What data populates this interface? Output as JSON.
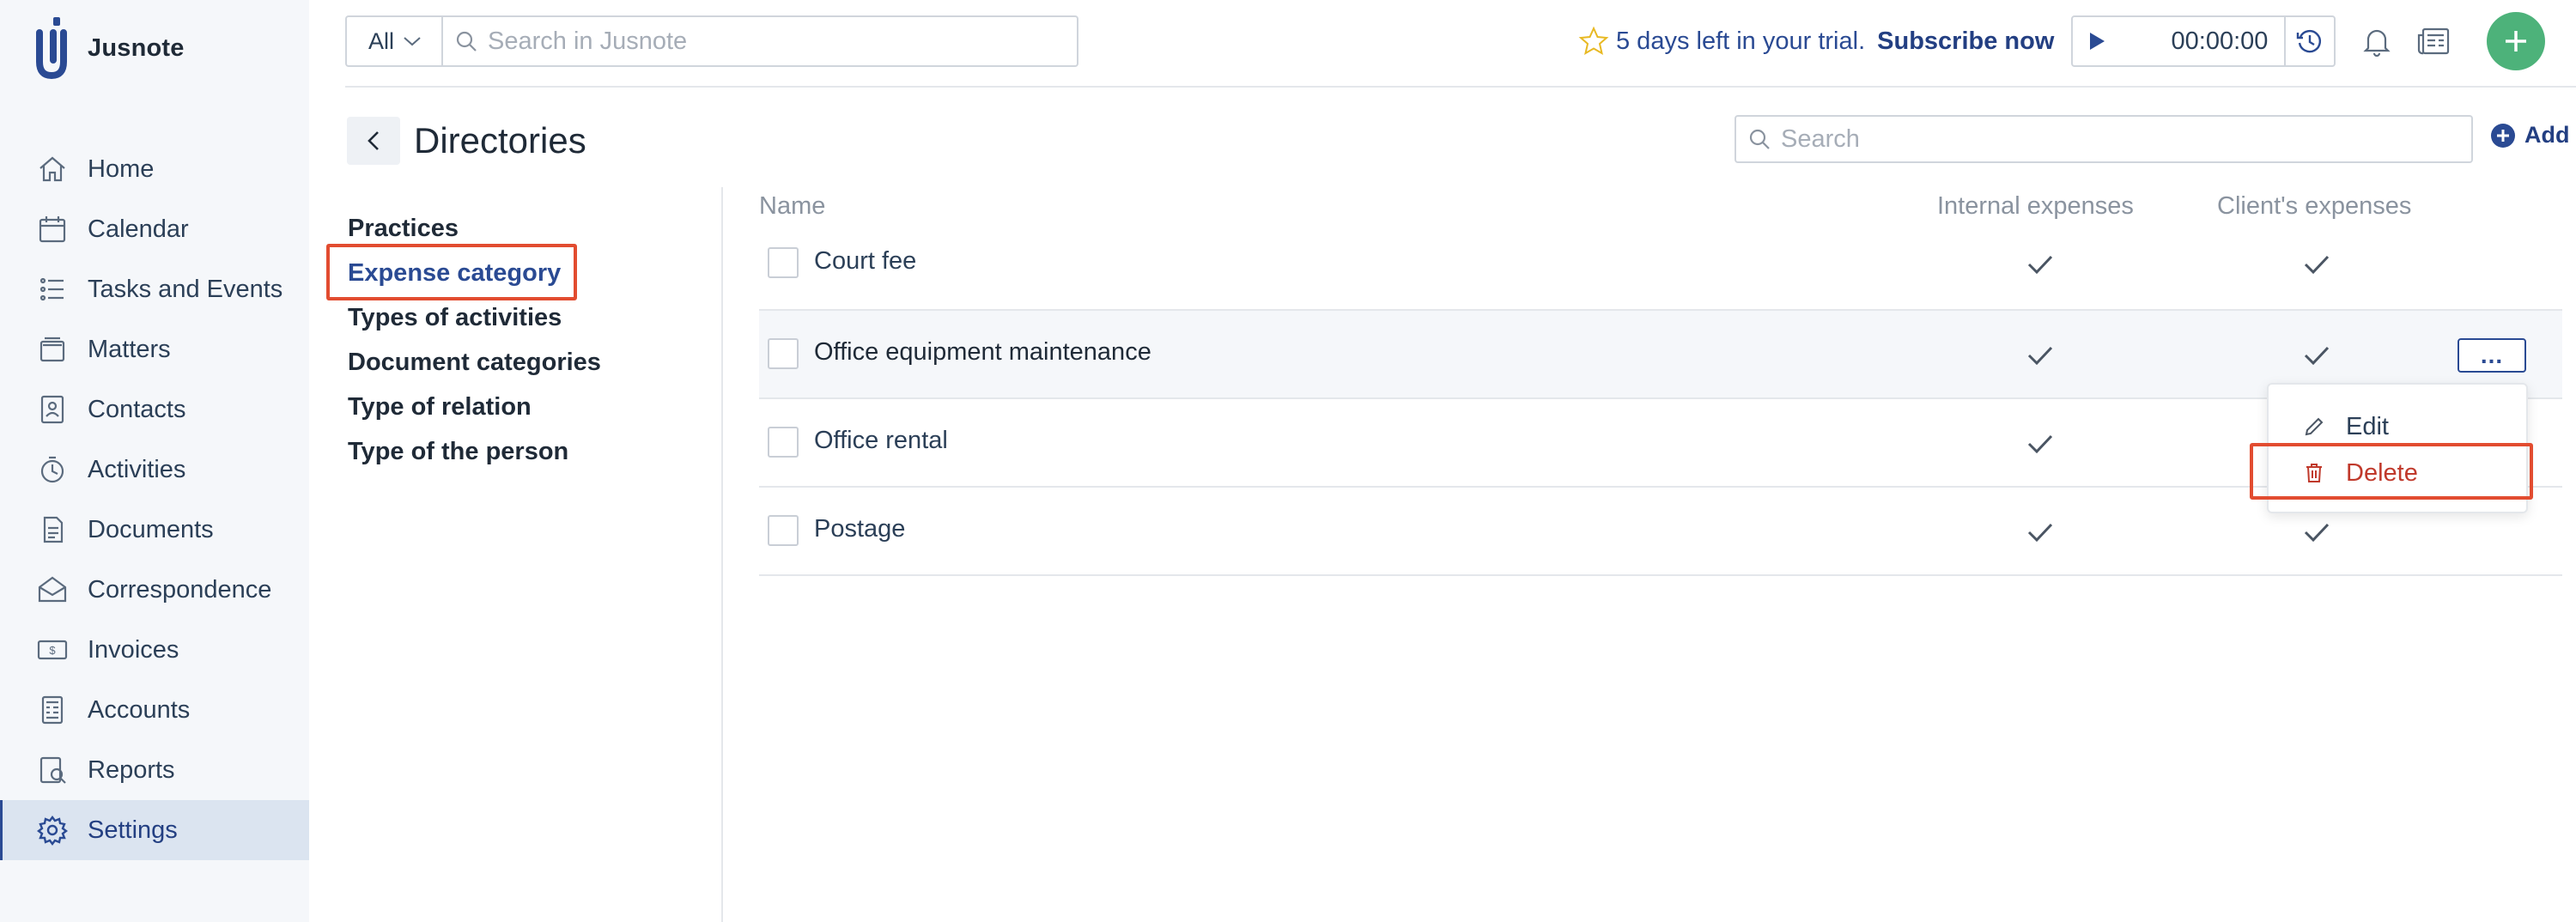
{
  "app": {
    "name": "Jusnote"
  },
  "sidebar": {
    "items": [
      {
        "label": "Home",
        "icon": "home-icon"
      },
      {
        "label": "Calendar",
        "icon": "calendar-icon"
      },
      {
        "label": "Tasks and Events",
        "icon": "tasks-icon"
      },
      {
        "label": "Matters",
        "icon": "matters-icon"
      },
      {
        "label": "Contacts",
        "icon": "contacts-icon"
      },
      {
        "label": "Activities",
        "icon": "activities-icon"
      },
      {
        "label": "Documents",
        "icon": "documents-icon"
      },
      {
        "label": "Correspondence",
        "icon": "correspondence-icon"
      },
      {
        "label": "Invoices",
        "icon": "invoices-icon"
      },
      {
        "label": "Accounts",
        "icon": "accounts-icon"
      },
      {
        "label": "Reports",
        "icon": "reports-icon"
      },
      {
        "label": "Settings",
        "icon": "settings-icon",
        "active": true
      }
    ]
  },
  "topbar": {
    "scope": "All",
    "search_placeholder": "Search in Jusnote",
    "trial_text": "5 days left in your trial.",
    "subscribe_label": "Subscribe now",
    "timer": "00:00:00"
  },
  "page": {
    "title": "Directories",
    "search_placeholder": "Search",
    "add_label": "Add"
  },
  "directories": [
    {
      "label": "Practices"
    },
    {
      "label": "Expense category",
      "active": true
    },
    {
      "label": "Types of activities"
    },
    {
      "label": "Document categories"
    },
    {
      "label": "Type of relation"
    },
    {
      "label": "Type of the person"
    }
  ],
  "table": {
    "columns": {
      "name": "Name",
      "internal": "Internal expenses",
      "client": "Client's expenses"
    },
    "rows": [
      {
        "name": "Court fee",
        "internal": true,
        "client": true
      },
      {
        "name": "Office equipment maintenance",
        "internal": true,
        "client": true
      },
      {
        "name": "Office rental",
        "internal": true,
        "client": true
      },
      {
        "name": "Postage",
        "internal": true,
        "client": true
      }
    ],
    "more_label": "..."
  },
  "menu": {
    "edit_label": "Edit",
    "delete_label": "Delete"
  },
  "colors": {
    "accent": "#2a4a93",
    "highlight": "#e24c30",
    "success": "#4db27a",
    "danger": "#c0392b",
    "trial_star": "#e8b923"
  }
}
